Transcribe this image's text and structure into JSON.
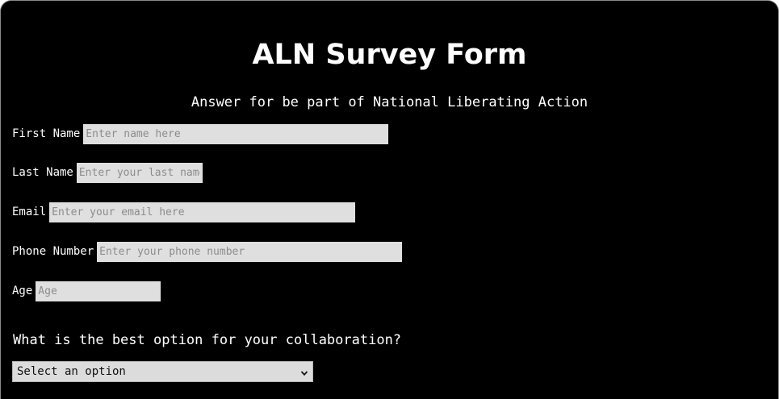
{
  "form": {
    "title": "ALN Survey Form",
    "subtitle": "Answer for be part of National Liberating Action",
    "fields": {
      "first_name": {
        "label": "First Name",
        "placeholder": "Enter name here",
        "value": ""
      },
      "last_name": {
        "label": "Last Name",
        "placeholder": "Enter your last name h",
        "value": ""
      },
      "email": {
        "label": "Email",
        "placeholder": "Enter your email here",
        "value": ""
      },
      "phone": {
        "label": "Phone Number",
        "placeholder": "Enter your phone number",
        "value": ""
      },
      "age": {
        "label": "Age",
        "placeholder": "Age",
        "value": ""
      }
    },
    "collaboration": {
      "question": "What is the best option for your collaboration?",
      "selected": "Select an option"
    }
  },
  "colors": {
    "background": "#000000",
    "text": "#ffffff",
    "input_bg": "#dfdfdf"
  },
  "icons": {
    "select_arrow": "chevron-down-icon"
  }
}
